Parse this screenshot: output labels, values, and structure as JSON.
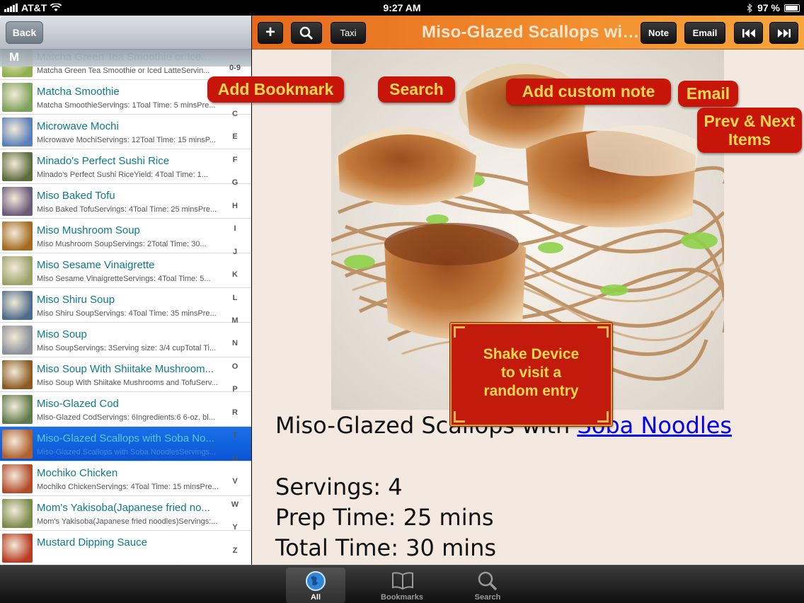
{
  "status_bar": {
    "carrier": "AT&T",
    "time": "9:27 AM",
    "battery": "97 %"
  },
  "left": {
    "back_label": "Back",
    "section_letter": "M",
    "items": [
      {
        "title": "Matcha Green Tea Smoothie or Ice...",
        "subtitle": "Matcha Green Tea Smoothie or Iced LatteServin..."
      },
      {
        "title": "Matcha Smoothie",
        "subtitle": "Matcha SmoothieServings: 1Toal Time: 5 minsPre..."
      },
      {
        "title": "Microwave Mochi",
        "subtitle": "Microwave MochiServings: 12Toal Time: 15 minsP..."
      },
      {
        "title": "Minado's Perfect Sushi Rice",
        "subtitle": "Minado's Perfect Sushi RiceYield:  4Toal Time: 1..."
      },
      {
        "title": "Miso Baked Tofu",
        "subtitle": "Miso Baked TofuServings: 4Toal Time: 25 minsPre..."
      },
      {
        "title": "Miso Mushroom Soup",
        "subtitle": "Miso Mushroom SoupServings: 2Total Time:  30..."
      },
      {
        "title": "Miso Sesame Vinaigrette",
        "subtitle": "Miso Sesame VinaigretteServings: 4Toal Time: 5..."
      },
      {
        "title": "Miso Shiru Soup",
        "subtitle": "Miso Shiru SoupServings: 4Toal Time: 35 minsPre..."
      },
      {
        "title": "Miso Soup",
        "subtitle": "Miso SoupServings: 3Serving size: 3/4 cupTotal Ti..."
      },
      {
        "title": "Miso Soup With Shiitake Mushroom...",
        "subtitle": "Miso Soup With Shiitake Mushrooms and TofuServ..."
      },
      {
        "title": "Miso-Glazed Cod",
        "subtitle": "Miso-Glazed CodServings: 6Ingredients:6  6-oz. bl..."
      },
      {
        "title": "Miso-Glazed Scallops with Soba No...",
        "subtitle": "Miso-Glazed Scallops with Soba NoodlesServings..."
      },
      {
        "title": "Mochiko Chicken",
        "subtitle": "Mochiko ChickenServings: 4Toal Time: 15 minsPre..."
      },
      {
        "title": "Mom's Yakisoba(Japanese fried no...",
        "subtitle": "Mom's Yakisoba(Japanese fried noodles)Servings:..."
      },
      {
        "title": "Mustard Dipping Sauce",
        "subtitle": ""
      }
    ],
    "index_letters": [
      "0-9",
      "B",
      "C",
      "E",
      "F",
      "G",
      "H",
      "I",
      "J",
      "K",
      "L",
      "M",
      "N",
      "O",
      "P",
      "R",
      "T",
      "U",
      "V",
      "W",
      "Y",
      "Z"
    ]
  },
  "toolbar": {
    "add_label": "+",
    "taxi_label": "Taxi",
    "title": "Miso-Glazed Scallops with Soba Noodles",
    "note_label": "Note",
    "email_label": "Email"
  },
  "recipe": {
    "heading_text": "Miso-Glazed Scallops with ",
    "heading_link": "Soba Noodles",
    "servings": "Servings: 4",
    "prep_time": "Prep Time: 25 mins",
    "total_time": "Total Time: 30 mins"
  },
  "callouts": {
    "add_bookmark": "Add Bookmark",
    "search": "Search",
    "add_note": "Add custom note",
    "email": "Email",
    "prev_next_line1": "Prev & Next",
    "prev_next_line2": "Items",
    "shake_line1": "Shake Device",
    "shake_line2": "to visit a",
    "shake_line3": "random entry"
  },
  "tabs": [
    {
      "label": "All",
      "icon": "globe-icon"
    },
    {
      "label": "Bookmarks",
      "icon": "book-icon"
    },
    {
      "label": "Search",
      "icon": "magnifier-icon"
    }
  ],
  "colors": {
    "toolbar_orange": "#f0862a",
    "callout_red": "#c8150a",
    "callout_text": "#ffd84a",
    "list_title": "#0d7a8a",
    "selected_row": "#0a55d4"
  }
}
